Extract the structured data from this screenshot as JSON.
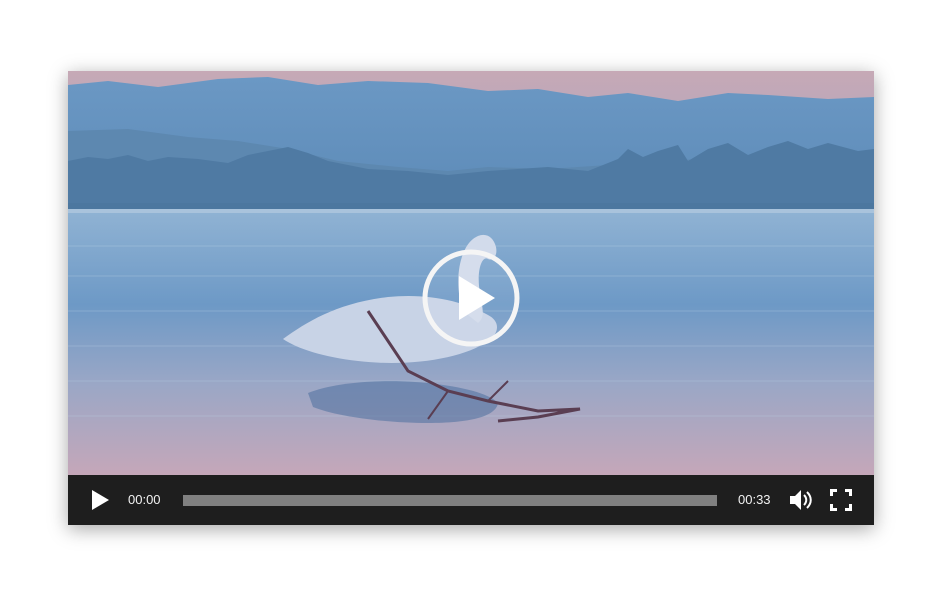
{
  "player": {
    "current_time": "00:00",
    "duration": "00:33",
    "progress_fraction": 0,
    "icons": {
      "big_play": "play-circle-icon",
      "play": "play-icon",
      "volume": "volume-icon",
      "fullscreen": "fullscreen-icon"
    },
    "colors": {
      "control_bar": "#1e1e1e",
      "progress_track": "#808080",
      "text": "#f2f2f2"
    }
  }
}
